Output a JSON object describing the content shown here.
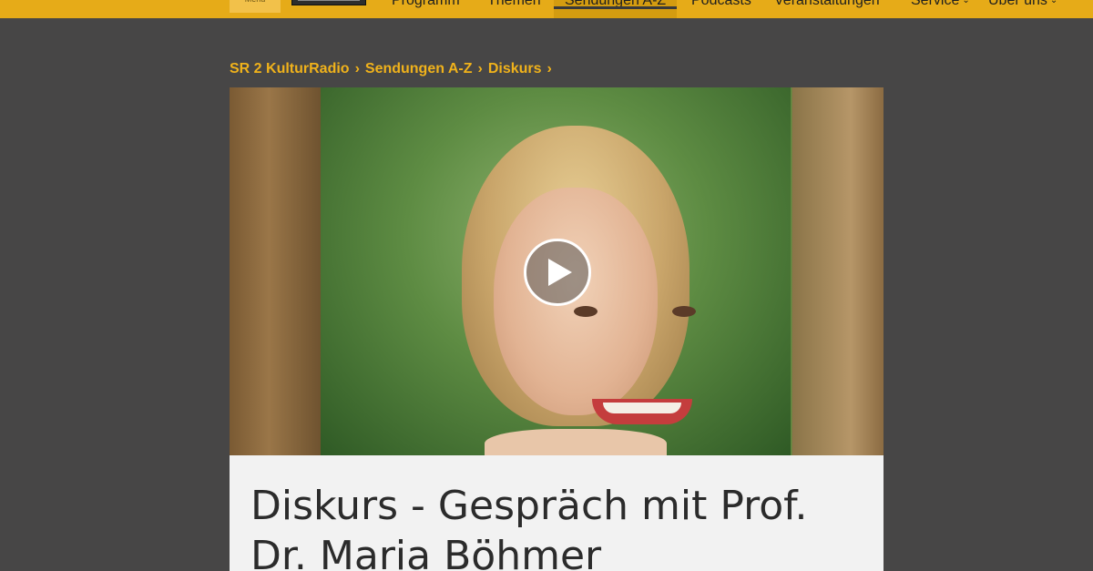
{
  "nav": {
    "menu_label": "Menü",
    "items": [
      {
        "label": "Programm",
        "active": false,
        "dropdown": false
      },
      {
        "label": "Themen",
        "active": false,
        "dropdown": false
      },
      {
        "label": "Sendungen A-Z",
        "active": true,
        "dropdown": false
      },
      {
        "label": "Podcasts",
        "active": false,
        "dropdown": false
      },
      {
        "label": "Veranstaltungen",
        "active": false,
        "dropdown": false
      },
      {
        "label": "Service",
        "active": false,
        "dropdown": true
      },
      {
        "label": "Über uns",
        "active": false,
        "dropdown": true
      }
    ],
    "chevron": "⌄"
  },
  "breadcrumb": {
    "items": [
      "SR 2 KulturRadio",
      "Sendungen A-Z",
      "Diskurs"
    ],
    "separator": "›"
  },
  "hero": {
    "play_icon": "play-icon"
  },
  "article": {
    "title": "Diskurs - Gespräch mit Prof. Dr. Maria Böhmer"
  },
  "colors": {
    "topbar": "#e6ab18",
    "accent_text": "#f0b21b",
    "page_background": "#474646",
    "card_background": "#f2f2f2"
  }
}
